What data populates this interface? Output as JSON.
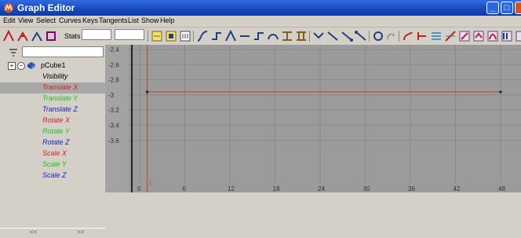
{
  "window": {
    "title": "Graph Editor",
    "app_icon": "maya-icon"
  },
  "menubar": {
    "items": [
      "Edit",
      "View",
      "Select",
      "Curves",
      "Keys",
      "Tangents",
      "List",
      "Show",
      "Help"
    ]
  },
  "toolbar": {
    "stats_label": "Stats",
    "stats_value_1": "",
    "stats_value_2": ""
  },
  "outliner": {
    "filter_value": "",
    "root_node": "pCube1",
    "selected_channel": "Translate X",
    "channels": [
      {
        "label": "Visibility",
        "color": "#000000"
      },
      {
        "label": "Translate X",
        "color": "#d02020"
      },
      {
        "label": "Translate Y",
        "color": "#20c020"
      },
      {
        "label": "Translate Z",
        "color": "#2020c0"
      },
      {
        "label": "Rotate X",
        "color": "#d02020"
      },
      {
        "label": "Rotate Y",
        "color": "#20c020"
      },
      {
        "label": "Rotate Z",
        "color": "#2020c0"
      },
      {
        "label": "Scale X",
        "color": "#d02020"
      },
      {
        "label": "Scale Y",
        "color": "#20c020"
      },
      {
        "label": "Scale Z",
        "color": "#2020c0"
      }
    ],
    "scroll_left": "<<",
    "scroll_right": ">>"
  },
  "graph": {
    "background_color": "#9b9b9b",
    "x_ticks": [
      "0",
      "6",
      "12",
      "18",
      "24",
      "30",
      "36",
      "42",
      "48"
    ],
    "y_ticks": [
      "-2.4",
      "-2.6",
      "-2.8",
      "-3",
      "-3.2",
      "-3.4",
      "-3.6"
    ],
    "current_time_marker": "1",
    "curve": {
      "channel": "Translate X",
      "color": "#c83a2a",
      "keys": [
        [
          1,
          -2.96
        ],
        [
          48,
          -2.96
        ]
      ]
    }
  }
}
